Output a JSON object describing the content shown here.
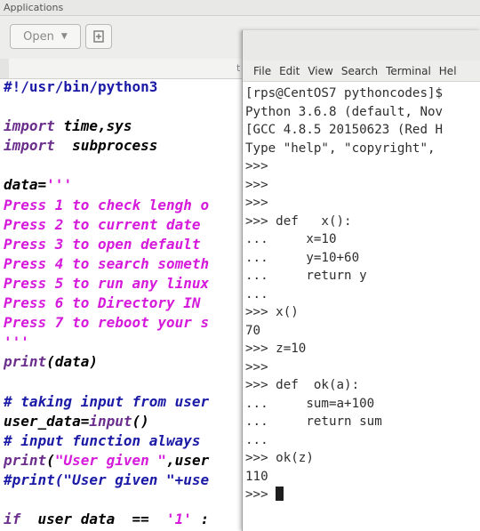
{
  "app_strip": {
    "label": "Applications"
  },
  "toolbar": {
    "open_label": "Open"
  },
  "tab": {
    "tail": "t"
  },
  "editor": {
    "lines": [
      {
        "parts": [
          {
            "t": "#!/usr/bin/python3",
            "c": "c-shebang"
          }
        ]
      },
      {
        "parts": []
      },
      {
        "parts": [
          {
            "t": "import",
            "c": "c-kw"
          },
          {
            "t": " time,sys",
            "c": ""
          }
        ]
      },
      {
        "parts": [
          {
            "t": "import",
            "c": "c-kw"
          },
          {
            "t": "  subprocess",
            "c": ""
          }
        ]
      },
      {
        "parts": []
      },
      {
        "parts": [
          {
            "t": "data=",
            "c": ""
          },
          {
            "t": "'''",
            "c": "c-str"
          }
        ]
      },
      {
        "parts": [
          {
            "t": "Press 1 to check lengh o",
            "c": "c-str"
          }
        ]
      },
      {
        "parts": [
          {
            "t": "Press 2 to current date",
            "c": "c-str"
          }
        ]
      },
      {
        "parts": [
          {
            "t": "Press 3 to open default",
            "c": "c-str"
          }
        ]
      },
      {
        "parts": [
          {
            "t": "Press 4 to search someth",
            "c": "c-str"
          }
        ]
      },
      {
        "parts": [
          {
            "t": "Press 5 to run any linux",
            "c": "c-str"
          }
        ]
      },
      {
        "parts": [
          {
            "t": "Press 6 to Directory IN",
            "c": "c-str"
          }
        ]
      },
      {
        "parts": [
          {
            "t": "Press 7 to reboot your s",
            "c": "c-str"
          }
        ]
      },
      {
        "parts": [
          {
            "t": "'''",
            "c": "c-str"
          }
        ]
      },
      {
        "parts": [
          {
            "t": "print",
            "c": "c-fn"
          },
          {
            "t": "(data)",
            "c": ""
          }
        ]
      },
      {
        "parts": []
      },
      {
        "parts": [
          {
            "t": "# taking input from user",
            "c": "c-comment"
          }
        ]
      },
      {
        "parts": [
          {
            "t": "user_data=",
            "c": ""
          },
          {
            "t": "input",
            "c": "c-fn"
          },
          {
            "t": "()",
            "c": ""
          }
        ]
      },
      {
        "parts": [
          {
            "t": "# input function always",
            "c": "c-comment"
          }
        ]
      },
      {
        "parts": [
          {
            "t": "print",
            "c": "c-fn"
          },
          {
            "t": "(",
            "c": ""
          },
          {
            "t": "\"User given \"",
            "c": "c-str"
          },
          {
            "t": ",user",
            "c": ""
          }
        ]
      },
      {
        "parts": [
          {
            "t": "#print(\"User given \"+use",
            "c": "c-comment"
          }
        ]
      },
      {
        "parts": []
      },
      {
        "parts": [
          {
            "t": "if",
            "c": "c-kw"
          },
          {
            "t": "  user data  ==  ",
            "c": ""
          },
          {
            "t": "'1'",
            "c": "c-str"
          },
          {
            "t": " :",
            "c": ""
          }
        ]
      }
    ]
  },
  "terminal": {
    "menu": [
      "File",
      "Edit",
      "View",
      "Search",
      "Terminal",
      "Hel"
    ],
    "lines": [
      "[rps@CentOS7 pythoncodes]$",
      "Python 3.6.8 (default, Nov",
      "[GCC 4.8.5 20150623 (Red H",
      "Type \"help\", \"copyright\",",
      ">>>",
      ">>>",
      ">>>",
      ">>> def   x():",
      "...     x=10",
      "...     y=10+60",
      "...     return y",
      "...",
      ">>> x()",
      "70",
      ">>> z=10",
      ">>>",
      ">>> def  ok(a):",
      "...     sum=a+100",
      "...     return sum",
      "...",
      ">>> ok(z)",
      "110",
      ">>> "
    ]
  }
}
